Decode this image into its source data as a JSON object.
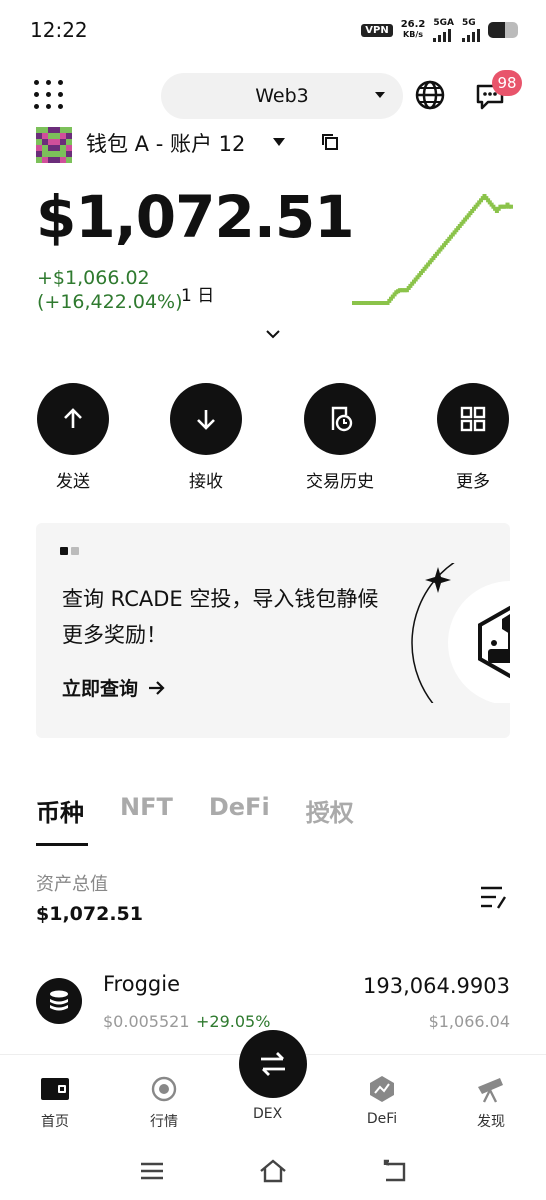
{
  "status_bar": {
    "time": "12:22",
    "vpn": "VPN",
    "speed_value": "26.2",
    "speed_unit": "KB/s",
    "net1": "5GA",
    "net2": "5G"
  },
  "header": {
    "network_selector": "Web3",
    "notification_count": "98"
  },
  "wallet": {
    "name": "钱包 A - 账户 12"
  },
  "balance": {
    "total": "$1,072.51",
    "change_amount": "+$1,066.02",
    "change_percent": "(+16,422.04%)",
    "period": "1 日"
  },
  "actions": [
    {
      "label": "发送",
      "icon": "arrow-up-icon"
    },
    {
      "label": "接收",
      "icon": "arrow-down-icon"
    },
    {
      "label": "交易历史",
      "icon": "history-icon"
    },
    {
      "label": "更多",
      "icon": "grid-icon"
    }
  ],
  "banner": {
    "text": "查询 RCADE 空投，导入钱包静候更多奖励！",
    "link": "立即查询"
  },
  "tabs": [
    "币种",
    "NFT",
    "DeFi",
    "授权"
  ],
  "assets": {
    "label": "资产总值",
    "total": "$1,072.51",
    "tokens": [
      {
        "name": "Froggie",
        "price": "$0.005521",
        "change": "+29.05%",
        "amount": "193,064.9903",
        "value": "$1,066.04"
      }
    ]
  },
  "bottom_nav": [
    {
      "label": "首页",
      "icon": "wallet-icon"
    },
    {
      "label": "行情",
      "icon": "market-icon"
    },
    {
      "label": "DEX",
      "icon": "swap-icon"
    },
    {
      "label": "DeFi",
      "icon": "defi-icon"
    },
    {
      "label": "发现",
      "icon": "telescope-icon"
    }
  ],
  "colors": {
    "accent_green": "#2f7a2f",
    "sparkline": "#8bc34a",
    "badge": "#e8546b"
  },
  "sparkline_values": [
    0,
    0,
    0,
    0,
    0,
    0,
    0,
    0,
    0,
    0,
    0,
    0,
    0,
    0,
    0,
    0,
    0,
    0,
    0,
    0,
    2,
    4,
    6,
    8,
    10,
    11,
    12,
    12,
    12,
    12,
    12,
    14,
    16,
    18,
    20,
    22,
    24,
    26,
    28,
    30,
    32,
    34,
    36,
    38,
    40,
    42,
    44,
    46,
    48,
    50,
    52,
    54,
    56,
    58,
    60,
    62,
    64,
    66,
    68,
    70,
    72,
    74,
    76,
    78,
    80,
    82,
    84,
    86,
    88,
    90,
    92,
    94,
    96,
    98,
    100,
    98,
    96,
    94,
    92,
    90,
    88,
    86,
    88,
    90,
    90,
    90,
    90,
    92,
    90,
    90
  ]
}
